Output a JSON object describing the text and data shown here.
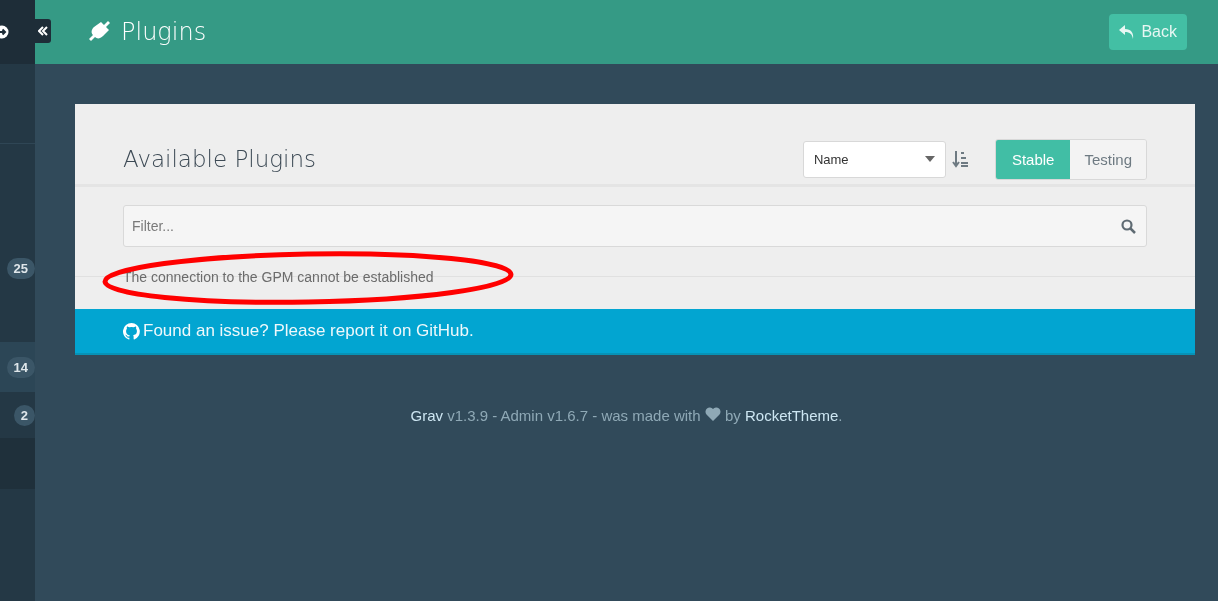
{
  "header": {
    "title": "Plugins",
    "back_button": "Back"
  },
  "sidebar": {
    "items": [
      {
        "badge": "25",
        "selected": false
      },
      {
        "badge": "14",
        "selected": true
      },
      {
        "badge": "2",
        "selected": false
      }
    ]
  },
  "panel": {
    "title": "Available Plugins",
    "sort": {
      "value": "Name"
    },
    "channels": [
      {
        "label": "Stable",
        "selected": true
      },
      {
        "label": "Testing",
        "selected": false
      }
    ],
    "filter": {
      "placeholder": "Filter..."
    },
    "message": "The connection to the GPM cannot be established",
    "issue_bar": "Found an issue? Please report it on GitHub."
  },
  "footer": {
    "grav_link": "Grav",
    "text_1": "v1.3.9 - Admin v1.6.7 - was made with",
    "text_2": "by",
    "rockettheme_link": "RocketTheme",
    "end": "."
  }
}
